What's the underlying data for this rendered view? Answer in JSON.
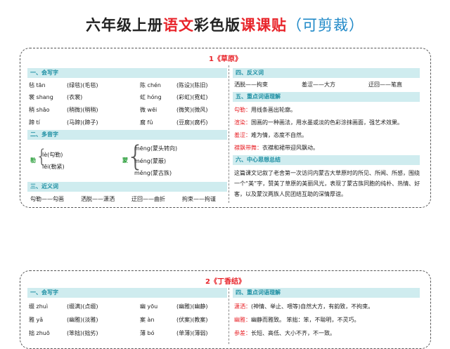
{
  "title": {
    "p1": "六年级上册",
    "p2": "语文",
    "p3": "彩色版",
    "p4": "课课贴",
    "p5": "（可剪裁）"
  },
  "lesson1": {
    "heading": "1《草原》",
    "s1": "一、会写字",
    "words": [
      [
        "毡 tān",
        "(绿毯)(毛毯)",
        "陈 chén",
        "(陈设)(陈旧)"
      ],
      [
        "裳 shang",
        "(衣裳)",
        "虹 hóng",
        "(彩虹)(霓虹)"
      ],
      [
        "稍 shāo",
        "(稍微)(稍稍)",
        "微 wēi",
        "(微笑)(微风)"
      ],
      [
        "蹄 tí",
        "(马蹄)(蹄子)",
        "腐 fǔ",
        "(豆腐)(腐朽)"
      ]
    ],
    "s2": "二、多音字",
    "poly1_char": "勒",
    "poly1": [
      "lè(勾勒)",
      "lēi(勒紧)"
    ],
    "poly2_char": "蒙",
    "poly2": [
      "mēng(蒙头转向)",
      "méng(蒙蔽)",
      "měng(蒙古族)"
    ],
    "s3": "三、近义词",
    "synonyms": [
      "勾勒——勾画",
      "洒脱——潇洒",
      "迂回——曲折",
      "拘束——拘谨"
    ],
    "s4": "四、反义词",
    "antonyms": [
      "洒脱——拘束",
      "羞涩——大方",
      "迂回——笔直"
    ],
    "s5": "五、重点词语理解",
    "terms": [
      {
        "word": "勾勒：",
        "color": "red",
        "def": "用线条画出轮廓。"
      },
      {
        "word": "渲染：",
        "color": "red",
        "def": "国画的一种画法，用水墨或淡的色彩涂抹画面，强艺术效果。"
      },
      {
        "word": "羞涩：",
        "color": "red",
        "def": "难为情，态度不自然。"
      },
      {
        "word": "襟飘带舞：",
        "color": "red",
        "def": "衣襟和裙带迎风飘动。"
      }
    ],
    "s6": "六、中心思想总结",
    "summary": "这篇课文记叙了老舍第一次访问内蒙古大草原时的所见、所闻、所感，围绕一个“美”字，赞美了草原的美丽风光，表现了蒙古族同胞的纯朴、热情、好客，以及蒙汉两族人民团结互助的深情厚谊。"
  },
  "lesson2": {
    "heading": "2《丁香结》",
    "s1": "一、会写字",
    "words": [
      [
        "缀 zhuì",
        "(缀满)(点缀)",
        "幽 yōu",
        "(幽雅)(幽静)"
      ],
      [
        "雅 yǎ",
        "(幽雅)(淡雅)",
        "案 àn",
        "(伏案)(教案)"
      ],
      [
        "拙 zhuō",
        "(笨拙)(拙劣)",
        "薄 bó",
        "(单薄)(薄弱)"
      ]
    ],
    "s4": "四、重点词语理解",
    "terms": [
      {
        "word": "潇洒：",
        "color": "red",
        "def": "(神情、举止、喂等)自然大方，有韵致，不拘束。"
      },
      {
        "word": "幽雅：",
        "color": "red",
        "def": "幽静而雅致。   笨拙：笨，不聪明，不灵巧。"
      },
      {
        "word": "参差：",
        "color": "red",
        "def": "长短、高低、大小不齐，不一致。"
      }
    ]
  }
}
